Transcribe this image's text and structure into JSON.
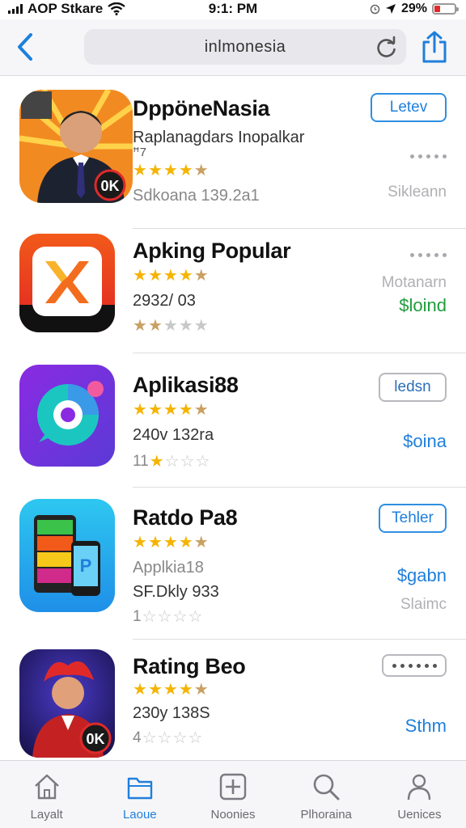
{
  "status_bar": {
    "carrier": "AOP Stkare",
    "time": "9:1: PM",
    "battery": "29%",
    "battery_level": 0.29
  },
  "nav": {
    "url": "inlmonesia"
  },
  "apps": [
    {
      "title": "DppöneNasia",
      "subtitle": "Raplanagdars Inopalkar",
      "small": "ꟸ7",
      "stars_filled": 4.5,
      "meta": "Sdkoana 139.2a1",
      "button": "Letev",
      "right_text": "Sikleann"
    },
    {
      "title": "Apking Popular",
      "stars_filled": 4.5,
      "meta": "2932/ 03",
      "rating_filled": 2,
      "right_top": "Motanarn",
      "price": "$loind"
    },
    {
      "title": "Aplikasi88",
      "stars_filled": 4.5,
      "meta": "240v 132ra",
      "rating_prefix": "11",
      "rating_filled": 1,
      "button": "ledsn",
      "price": "$oina"
    },
    {
      "title": "Ratdo Pa8",
      "stars_filled": 4.5,
      "meta": "Applkia18",
      "meta2": "SF.Dkly 933",
      "rating_prefix": "1",
      "rating_filled": 0,
      "button": "Tehler",
      "price": "$gabn",
      "right_text": "Slaimc"
    },
    {
      "title": "Rating Beo",
      "stars_filled": 4.5,
      "meta": "230y 138S",
      "rating_prefix": "4",
      "rating_filled": 0,
      "price": "Sthm"
    }
  ],
  "tabs": [
    {
      "label": "Layalt",
      "icon": "home-icon"
    },
    {
      "label": "Laoue",
      "icon": "folder-icon",
      "active": true
    },
    {
      "label": "Noonies",
      "icon": "plus-square-icon"
    },
    {
      "label": "Plhoraina",
      "icon": "search-icon"
    },
    {
      "label": "Uenices",
      "icon": "person-icon"
    }
  ],
  "colors": {
    "accent": "#1f7fdc",
    "star": "#f5b400",
    "green": "#1e9e3a",
    "battery_red": "#e02a2a"
  }
}
